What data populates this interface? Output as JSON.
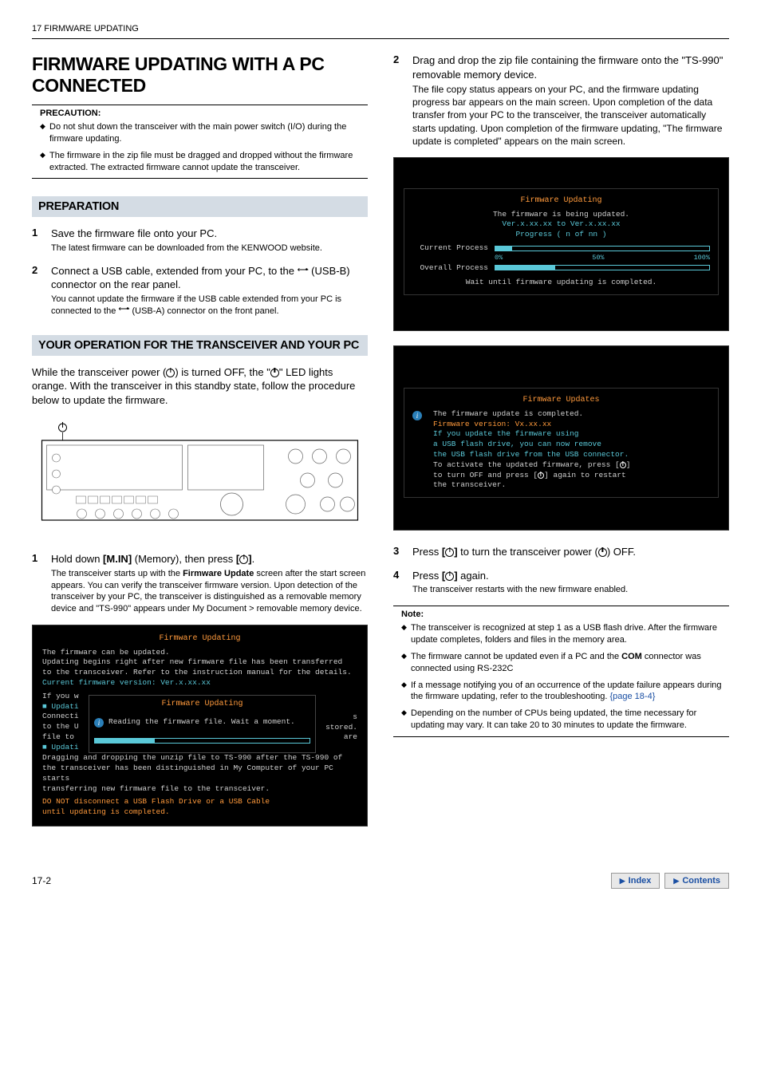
{
  "header": {
    "chapter": "17 FIRMWARE UPDATING"
  },
  "left": {
    "main_title": "FIRMWARE UPDATING WITH A PC CONNECTED",
    "precaution_label": "PRECAUTION:",
    "precautions": [
      "Do not shut down the transceiver with the main power switch (I/O) during the firmware updating.",
      "The firmware in the zip file must be dragged and dropped without the firmware extracted. The extracted firmware cannot update the transceiver."
    ],
    "preparation_heading": "PREPARATION",
    "prep_steps": [
      {
        "num": "1",
        "lead": "Save the firmware file onto your PC.",
        "detail": "The latest firmware can be downloaded from the KENWOOD website."
      },
      {
        "num": "2",
        "lead_a": "Connect a USB cable, extended from your PC, to the ",
        "lead_b": " (USB-B) connector on the rear panel.",
        "detail_a": "You cannot update the firmware if the USB cable extended from your PC is connected to the ",
        "detail_b": " (USB-A) connector on the front panel."
      }
    ],
    "operation_heading": "YOUR OPERATION FOR THE TRANSCEIVER AND YOUR PC",
    "operation_para_a": "While the transceiver power (",
    "operation_para_b": ") is turned OFF, the \"",
    "operation_para_c": "\" LED lights orange. With the transceiver in this standby state, follow the procedure below to update the firmware.",
    "step1": {
      "num": "1",
      "lead_a": "Hold down ",
      "lead_b": "[M.IN]",
      "lead_c": " (Memory), then press ",
      "lead_d": ".",
      "detail_a": "The transceiver starts up with the ",
      "detail_b": "Firmware Update",
      "detail_c": " screen after the start screen appears. You can verify the transceiver firmware version. Upon detection of the transceiver by your PC, the transceiver is distinguished as a removable memory device and \"TS-990\" appears under My Document > removable memory device."
    },
    "ss1": {
      "title": "Firmware Updating",
      "l1": "The firmware can be updated.",
      "l2": "Updating begins right after new firmware file has been transferred",
      "l3": "to the transceiver. Refer to the instruction manual for the details.",
      "l4": "Current firmware version: Ver.x.xx.xx",
      "l5": "If you w",
      "inner_title": "Firmware Updating",
      "l6": "■ Updati",
      "l7": "Connecti",
      "inner_msg": "Reading the firmware file. Wait a moment.",
      "l8": "to the U",
      "l8b": "s stored.",
      "l9": "file to",
      "l9b": "are",
      "l10": "■ Updati",
      "l11": "Dragging and dropping the unzip file to TS-990 after the TS-990 of",
      "l12": "the transceiver has been distinguished in My Computer of your PC starts",
      "l13": "transferring new firmware file to the transceiver.",
      "l14": "DO NOT disconnect a USB Flash Drive or a USB Cable",
      "l15": "until updating is completed."
    }
  },
  "right": {
    "step2": {
      "num": "2",
      "lead": "Drag and drop the zip file containing the firmware onto the \"TS-990\" removable memory device.",
      "detail": "The file copy status appears on your PC, and the firmware updating progress bar appears on the main screen. Upon completion of the data transfer from your PC to the transceiver, the transceiver automatically starts updating. Upon completion of the firmware updating, \"The firmware update is completed\" appears on the main screen."
    },
    "ss2": {
      "title": "Firmware Updating",
      "l1": "The firmware is being updated.",
      "l2": "Ver.x.xx.xx to Ver.x.xx.xx",
      "l3": "Progress ( n of nn )",
      "cur": "Current Process",
      "ovr": "Overall Process",
      "p0": "0%",
      "p50": "50%",
      "p100": "100%",
      "wait": "Wait until firmware updating is completed."
    },
    "ss3": {
      "title": "Firmware Updates",
      "l1": "The firmware update is completed.",
      "l2": "Firmware version: Vx.xx.xx",
      "l3": "If you update the firmware using",
      "l4": "a USB flash drive, you can now remove",
      "l5": "the USB flash drive from the USB connector.",
      "l6a": "To activate the updated firmware, press [",
      "l6b": "]",
      "l7a": "to turn OFF and press [",
      "l7b": "] again to restart",
      "l8": "the transceiver."
    },
    "step3": {
      "num": "3",
      "lead_a": "Press ",
      "lead_b": " to turn the transceiver power (",
      "lead_c": ") OFF."
    },
    "step4": {
      "num": "4",
      "lead_a": "Press ",
      "lead_b": " again.",
      "detail": "The transceiver restarts with the new firmware enabled."
    },
    "note_label": "Note:",
    "notes": [
      {
        "t": "The transceiver is recognized at step 1 as a USB flash drive. After the firmware update completes, folders and files in the memory area."
      },
      {
        "t_a": "The firmware cannot be updated even if a PC and the ",
        "bold": "COM",
        "t_b": " connector was connected using RS-232C"
      },
      {
        "t_a": "If a message notifying you of an occurrence of the update failure appears during the firmware updating, refer to the troubleshooting. ",
        "link": "{page 18-4}"
      },
      {
        "t": "Depending on the number of CPUs being updated, the time necessary for updating may vary. It can take 20 to 30 minutes to update the firmware."
      }
    ]
  },
  "footer": {
    "page": "17-2",
    "index": "Index",
    "contents": "Contents"
  }
}
